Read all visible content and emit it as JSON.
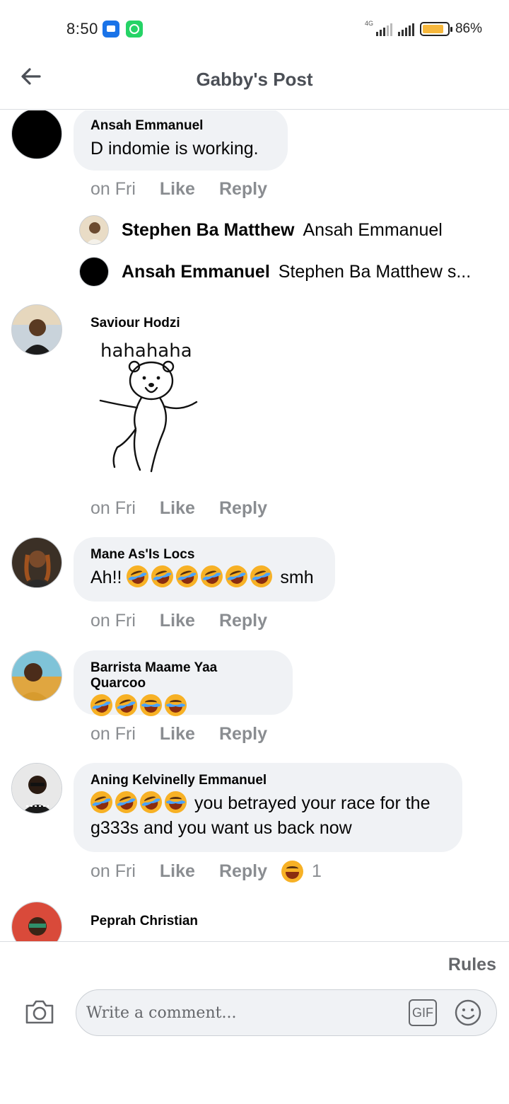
{
  "status_bar": {
    "time": "8:50",
    "network": "4G",
    "battery": "86%"
  },
  "header": {
    "title": "Gabby's Post"
  },
  "comments": [
    {
      "author": "Ansah Emmanuel",
      "text": "D indomie is working.",
      "time": "on Fri",
      "like": "Like",
      "reply": "Reply",
      "replies": [
        {
          "name": "Stephen Ba Matthew",
          "text": "Ansah Emmanuel"
        },
        {
          "name": "Ansah Emmanuel",
          "text": "Stephen Ba Matthew s..."
        }
      ]
    },
    {
      "author": "Saviour Hodzi",
      "sticker_text": "hahahaha",
      "time": "on Fri",
      "like": "Like",
      "reply": "Reply"
    },
    {
      "author": "Mane As'Is Locs",
      "text_prefix": "Ah!!",
      "text_suffix": "smh",
      "time": "on Fri",
      "like": "Like",
      "reply": "Reply"
    },
    {
      "author": "Barrista Maame Yaa Quarcoo",
      "time": "on Fri",
      "like": "Like",
      "reply": "Reply"
    },
    {
      "author": "Aning Kelvinelly Emmanuel",
      "text_line1": "you betrayed your race for the",
      "text_line2": "g333s and you want us back now",
      "time": "on Fri",
      "like": "Like",
      "reply": "Reply",
      "reaction_count": "1"
    },
    {
      "author": "Peprah Christian"
    }
  ],
  "footer": {
    "rules": "Rules",
    "comment_placeholder": "Write a comment...",
    "gif_label": "GIF"
  }
}
